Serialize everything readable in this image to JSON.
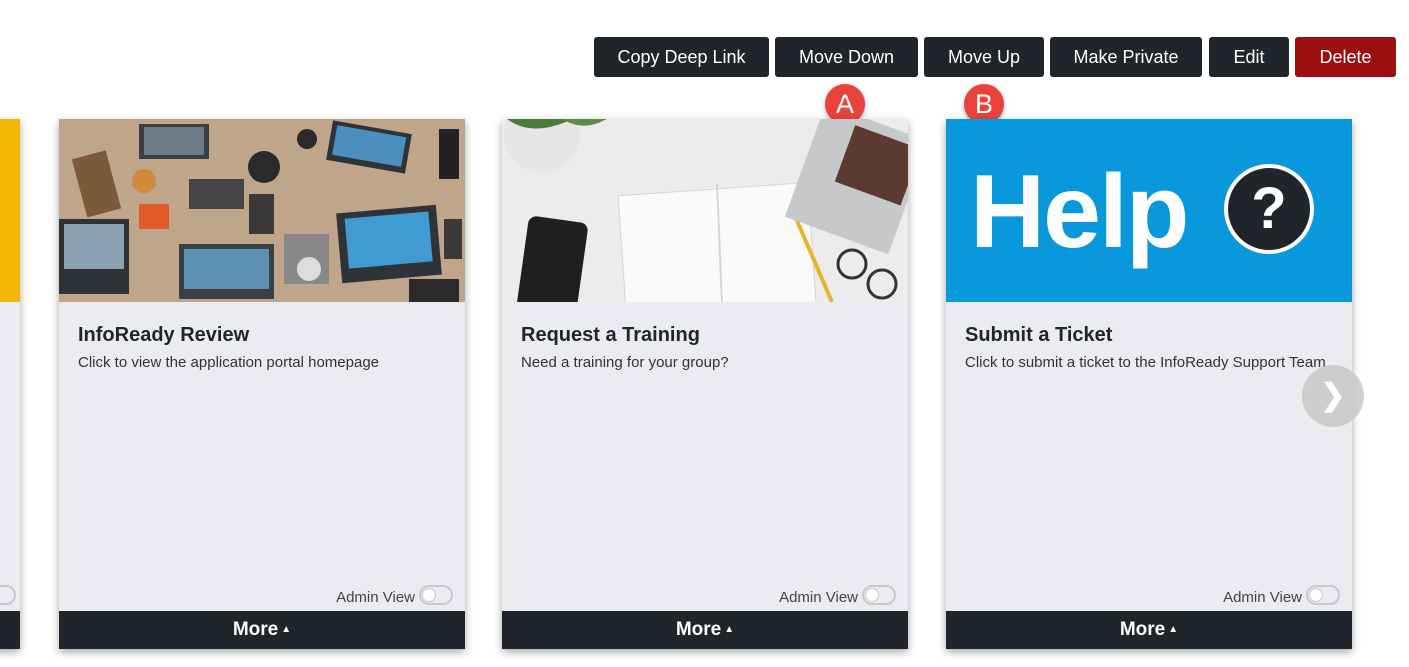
{
  "toolbar": {
    "copy_deep_link": "Copy Deep Link",
    "move_down": "Move Down",
    "move_up": "Move Up",
    "make_private": "Make Private",
    "edit": "Edit",
    "delete": "Delete"
  },
  "markers": {
    "a": "A",
    "b": "B"
  },
  "cards": [
    {
      "title": "InfoReady Review",
      "description": "Click to view the application portal homepage",
      "admin_label": "Admin View",
      "more_label": "More",
      "image": "desk-laptops-photo"
    },
    {
      "title": "Request a Training",
      "description": "Need a training for your group?",
      "admin_label": "Admin View",
      "more_label": "More",
      "image": "notebook-desk-photo"
    },
    {
      "title": "Submit a Ticket",
      "description": "Click to submit a ticket to the InfoReady Support Team",
      "admin_label": "Admin View",
      "more_label": "More",
      "image_text": "Help",
      "image_icon_text": "?"
    }
  ],
  "icons": {
    "next": "chevron-right-icon",
    "caret": "caret-up-icon"
  },
  "colors": {
    "dark": "#1f252b",
    "danger": "#9b0f0f",
    "marker": "#e8423d",
    "help_blue": "#0a98dc",
    "card_bg": "#ebecf0"
  }
}
